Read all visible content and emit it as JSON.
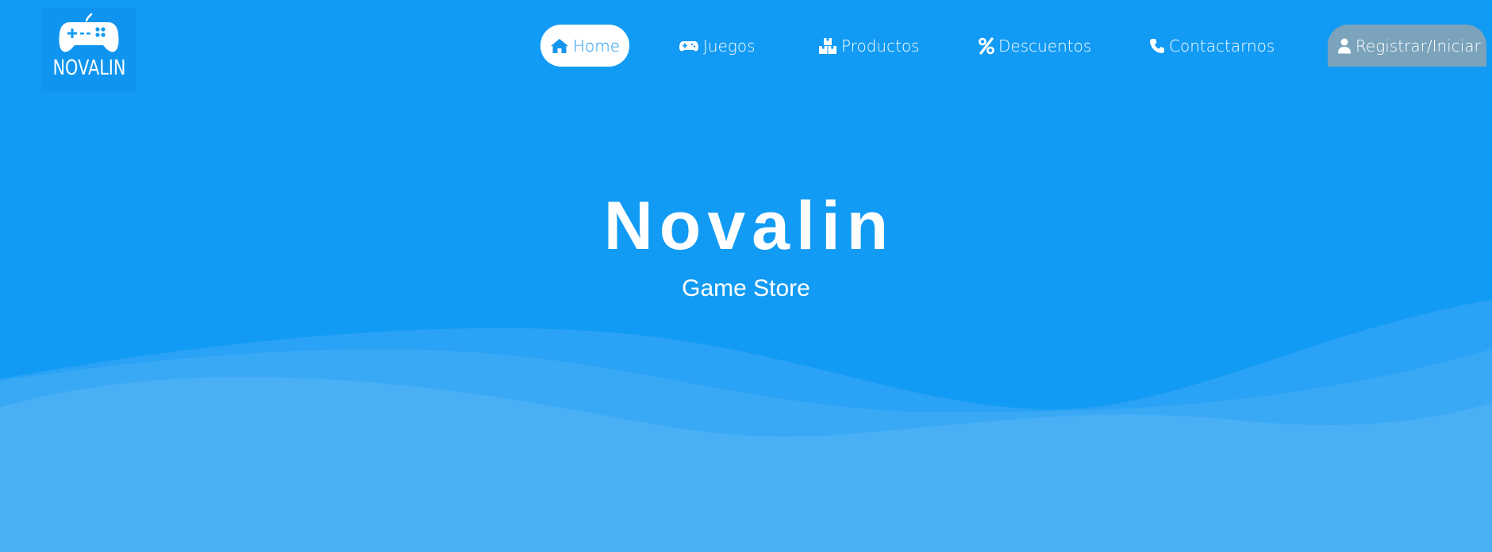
{
  "brand": {
    "logo_text": "NOVALIN"
  },
  "nav": {
    "items": [
      {
        "label": "Home",
        "icon": "home-icon",
        "active": true
      },
      {
        "label": "Juegos",
        "icon": "gamepad-icon"
      },
      {
        "label": "Productos",
        "icon": "boxes-icon"
      },
      {
        "label": "Descuentos",
        "icon": "percent-icon"
      },
      {
        "label": "Contactarnos",
        "icon": "phone-icon"
      },
      {
        "label": "Registrar/Iniciar",
        "icon": "user-icon"
      }
    ]
  },
  "hero": {
    "title": "Novalin",
    "subtitle": "Game Store"
  },
  "colors": {
    "background": "#129bf4",
    "wave_light": "#4ab0f6",
    "wave_mid": "#3aa9f5",
    "nav_active_bg": "#ffffff",
    "nav_active_text": "#1596ee",
    "register_bg": "#7ba3bb",
    "text": "#ffffff"
  }
}
